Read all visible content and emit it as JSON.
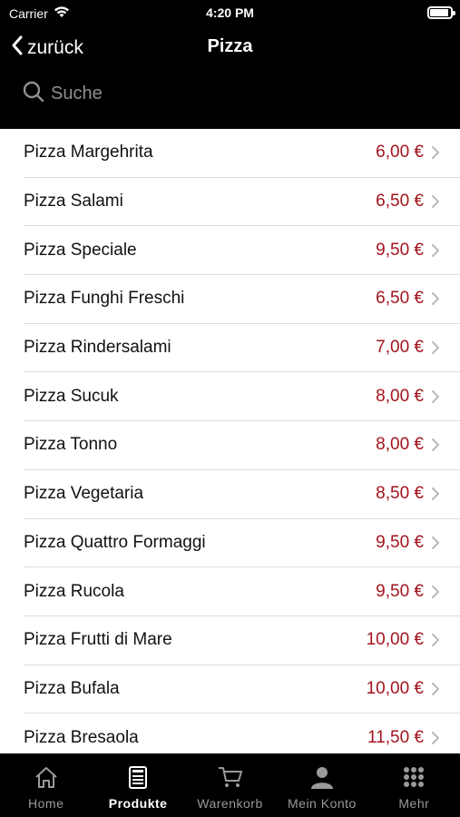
{
  "status_bar": {
    "carrier": "Carrier",
    "time": "4:20 PM",
    "battery_level": 0.9
  },
  "nav": {
    "back_label": "zurück",
    "title": "Pizza"
  },
  "search": {
    "placeholder": "Suche",
    "value": ""
  },
  "products": [
    {
      "name": "Pizza Margehrita",
      "price": "6,00 €"
    },
    {
      "name": "Pizza Salami",
      "price": "6,50 €"
    },
    {
      "name": "Pizza Speciale",
      "price": "9,50 €"
    },
    {
      "name": "Pizza Funghi Freschi",
      "price": "6,50 €"
    },
    {
      "name": "Pizza Rindersalami",
      "price": "7,00 €"
    },
    {
      "name": "Pizza Sucuk",
      "price": "8,00 €"
    },
    {
      "name": "Pizza Tonno",
      "price": "8,00 €"
    },
    {
      "name": "Pizza Vegetaria",
      "price": "8,50 €"
    },
    {
      "name": "Pizza Quattro Formaggi",
      "price": "9,50 €"
    },
    {
      "name": "Pizza Rucola",
      "price": "9,50 €"
    },
    {
      "name": "Pizza Frutti di Mare",
      "price": "10,00 €"
    },
    {
      "name": "Pizza Bufala",
      "price": "10,00 €"
    },
    {
      "name": "Pizza Bresaola",
      "price": "11,50 €"
    }
  ],
  "tabs": [
    {
      "label": "Home",
      "icon": "home-icon",
      "active": false
    },
    {
      "label": "Produkte",
      "icon": "menu-card-icon",
      "active": true
    },
    {
      "label": "Warenkorb",
      "icon": "cart-icon",
      "active": false
    },
    {
      "label": "Mein Konto",
      "icon": "person-icon",
      "active": false
    },
    {
      "label": "Mehr",
      "icon": "grid-icon",
      "active": false
    }
  ],
  "colors": {
    "price": "#a3141e",
    "bar_background": "#000000",
    "tab_inactive": "#9a9a9a"
  }
}
